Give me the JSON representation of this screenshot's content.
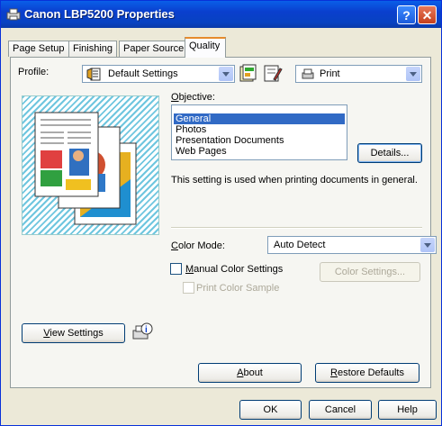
{
  "window": {
    "title": "Canon LBP5200 Properties",
    "help_glyph": "?",
    "close_glyph": "✕"
  },
  "tabs": [
    {
      "label": "Page Setup"
    },
    {
      "label": "Finishing"
    },
    {
      "label": "Paper Source"
    },
    {
      "label": "Quality",
      "active": true
    }
  ],
  "profile": {
    "label": "Profile:",
    "value": "Default Settings",
    "output_value": "Print"
  },
  "objective": {
    "label": "Objective:",
    "items": [
      "General",
      "Photos",
      "Presentation Documents",
      "Web Pages"
    ],
    "selected": "General",
    "details_label": "Details...",
    "description": "This setting is used when printing documents in general."
  },
  "color_mode": {
    "label": "Color Mode:",
    "value": "Auto Detect"
  },
  "manual_color": {
    "label": "Manual Color Settings",
    "checked": false,
    "settings_label": "Color Settings..."
  },
  "print_sample": {
    "label": "Print Color Sample",
    "checked": false
  },
  "view_settings_label": "View Settings",
  "about_label": "About",
  "restore_label": "Restore Defaults",
  "footer": {
    "ok": "OK",
    "cancel": "Cancel",
    "help": "Help"
  },
  "colors": {
    "title_bar": "#0a3fce",
    "selection": "#316ac5",
    "tab_highlight": "#e68b2c"
  }
}
